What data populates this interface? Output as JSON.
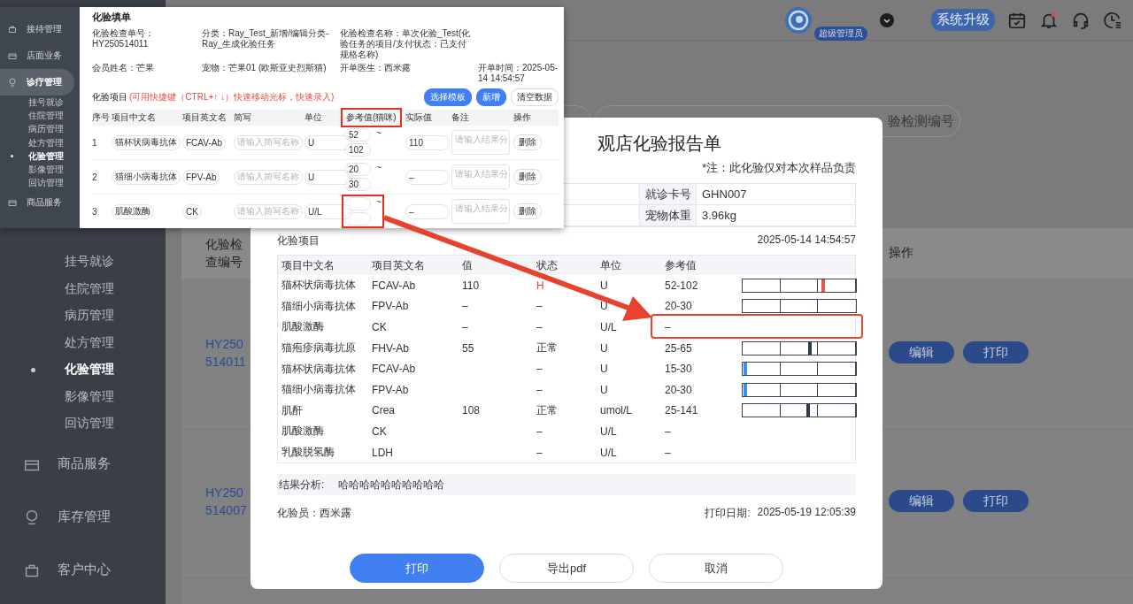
{
  "sidebar": {
    "items": [
      {
        "label": "挂号就诊",
        "kind": "sub",
        "selected": false
      },
      {
        "label": "住院管理",
        "kind": "sub",
        "selected": false
      },
      {
        "label": "病历管理",
        "kind": "sub",
        "selected": false
      },
      {
        "label": "处方管理",
        "kind": "sub",
        "selected": false
      },
      {
        "label": "化验管理",
        "kind": "sub",
        "selected": true
      },
      {
        "label": "影像管理",
        "kind": "sub",
        "selected": false
      },
      {
        "label": "回访管理",
        "kind": "sub",
        "selected": false
      },
      {
        "label": "商品服务",
        "kind": "group",
        "selected": false
      },
      {
        "label": "库存管理",
        "kind": "group",
        "selected": false
      },
      {
        "label": "客户中心",
        "kind": "group",
        "selected": false
      }
    ]
  },
  "header": {
    "role_badge": "超级管理员",
    "upgrade_button": "系统升级",
    "bell_unread": true
  },
  "search": {
    "placeholder": "验检测编号"
  },
  "table": {
    "columns": [
      "化验检查编号",
      "操作"
    ],
    "rows": [
      {
        "id": "HY250514011",
        "actions": [
          "编辑",
          "打印"
        ]
      },
      {
        "id": "HY250514007",
        "actions": [
          "编辑",
          "打印"
        ]
      }
    ]
  },
  "report": {
    "title": "观店化验报告单",
    "note": "*注：此化验仅对本次样品负责",
    "info": [
      {
        "label": "就诊卡号",
        "value": "GHN007"
      },
      {
        "label": "宠物体重",
        "value": "3.96kg"
      }
    ],
    "section": "化验项目",
    "date": "2025-05-14 14:54:57",
    "columns": [
      "项目中文名",
      "项目英文名",
      "值",
      "状态",
      "单位",
      "参考值"
    ],
    "rows": [
      {
        "cn": "猫杯状病毒抗体",
        "en": "FCAV-Ab",
        "value": "110",
        "status": "H",
        "abnormal": true,
        "unit": "U",
        "ref": "52-102",
        "highlighted": false,
        "has_bar": true,
        "marker": {
          "level": 0.72,
          "color": "#e8584a"
        }
      },
      {
        "cn": "猫细小病毒抗体",
        "en": "FPV-Ab",
        "value": "–",
        "status": "–",
        "abnormal": false,
        "unit": "U",
        "ref": "20-30",
        "highlighted": false,
        "has_bar": true
      },
      {
        "cn": "肌酸激酶",
        "en": "CK",
        "value": "–",
        "status": "–",
        "abnormal": false,
        "unit": "U/L",
        "ref": "–",
        "highlighted": true,
        "has_bar": false
      },
      {
        "cn": "猫疱疹病毒抗原",
        "en": "FHV-Ab",
        "value": "55",
        "status": "正常",
        "abnormal": false,
        "unit": "U",
        "ref": "25-65",
        "highlighted": false,
        "has_bar": true,
        "marker": {
          "level": 0.6,
          "color": "#2c3a55"
        }
      },
      {
        "cn": "猫杯状病毒抗体",
        "en": "FCAV-Ab",
        "status": "–",
        "abnormal": false,
        "unit": "U",
        "ref": "15-30",
        "highlighted": false,
        "has_bar": true,
        "marker": {
          "level": 0.01,
          "color": "#3a8ef0"
        }
      },
      {
        "cn": "猫细小病毒抗体",
        "en": "FPV-Ab",
        "status": "–",
        "abnormal": false,
        "unit": "U",
        "ref": "20-30",
        "highlighted": false,
        "has_bar": true,
        "marker": {
          "level": 0.01,
          "color": "#3a8ef0"
        }
      },
      {
        "cn": "肌酐",
        "en": "Crea",
        "value": "108",
        "status": "正常",
        "abnormal": false,
        "unit": "umol/L",
        "ref": "25-141",
        "highlighted": false,
        "has_bar": true,
        "marker": {
          "level": 0.58,
          "color": "#2c3a55"
        }
      },
      {
        "cn": "肌酸激酶",
        "en": "CK",
        "status": "–",
        "abnormal": false,
        "unit": "U/L",
        "ref": "–",
        "highlighted": false,
        "has_bar": false
      },
      {
        "cn": "乳酸脱氢酶",
        "en": "LDH",
        "status": "–",
        "abnormal": false,
        "unit": "U/L",
        "ref": "–",
        "highlighted": false,
        "has_bar": false
      }
    ],
    "analysis_label": "结果分析:",
    "analysis": "哈哈哈哈哈哈哈哈哈哈",
    "tester": "化验员：西米露",
    "print_date_label": "打印日期:",
    "print_date": "2025-05-19 12:05:39",
    "buttons": [
      {
        "label": "打印",
        "kind": "primary"
      },
      {
        "label": "导出pdf",
        "kind": "plain"
      },
      {
        "label": "取消",
        "kind": "plain"
      }
    ]
  },
  "inset": {
    "sidebar": [
      {
        "label": "接待管理",
        "kind": "group",
        "selected": false
      },
      {
        "label": "店面业务",
        "kind": "group",
        "selected": false
      },
      {
        "label": "诊疗管理",
        "kind": "group",
        "selected": true
      },
      {
        "label": "挂号就诊",
        "kind": "sub",
        "selected": false
      },
      {
        "label": "住院管理",
        "kind": "sub",
        "selected": false
      },
      {
        "label": "病历管理",
        "kind": "sub",
        "selected": false
      },
      {
        "label": "处方管理",
        "kind": "sub",
        "selected": false
      },
      {
        "label": "化验管理",
        "kind": "sub",
        "selected": true
      },
      {
        "label": "影像管理",
        "kind": "sub",
        "selected": false
      },
      {
        "label": "回访管理",
        "kind": "sub",
        "selected": false
      },
      {
        "label": "商品服务",
        "kind": "group",
        "selected": false
      }
    ],
    "title": "化验填单",
    "fields": [
      "化验检查单号：HY250514011",
      "分类：Ray_Test_新增/编辑分类-Ray_生成化验任务",
      "化验检查名称：单次化验_Test(化验任务的项目/支付状态：已支付规格名称)",
      "会员姓名：芒果",
      "宠物：芒果01 (欧斯亚史烈斯猫)",
      "开单医生：西米露",
      "开单时间：2025-05-14 14:54:57"
    ],
    "section": "化验项目",
    "hint": "(可用快捷键（CTRL+↑ ↓）快速移动光标，快速录入)",
    "buttons": [
      {
        "label": "选择模板",
        "kind": "primary"
      },
      {
        "label": "新增",
        "kind": "primary"
      },
      {
        "label": "清空数据",
        "kind": "plain"
      }
    ],
    "columns": [
      {
        "label": "序号",
        "highlighted": false
      },
      {
        "label": "项目中文名",
        "highlighted": false
      },
      {
        "label": "项目英文名",
        "highlighted": false
      },
      {
        "label": "简写",
        "highlighted": false
      },
      {
        "label": "单位",
        "highlighted": false
      },
      {
        "label": "参考值(猫咪)",
        "highlighted": true
      },
      {
        "label": "实际值",
        "highlighted": false
      },
      {
        "label": "备注",
        "highlighted": false
      },
      {
        "label": "操作",
        "highlighted": false
      }
    ],
    "rows": [
      {
        "no": "1",
        "cn": "猫杯状病毒抗体",
        "en": "FCAV-Ab",
        "abbr_placeholder": "请输入简写名称",
        "unit": "U",
        "ref_low": "52",
        "ref_high": "102",
        "separator": "~",
        "ref_highlighted": false,
        "actual": "110",
        "note_placeholder": "请输入结果分",
        "action": "删除"
      },
      {
        "no": "2",
        "cn": "猫细小病毒抗体",
        "en": "FPV-Ab",
        "abbr_placeholder": "请输入简写名称",
        "unit": "U",
        "ref_low": "20",
        "ref_high": "30",
        "separator": "~",
        "ref_highlighted": false,
        "actual": "–",
        "note_placeholder": "请输入结果分",
        "action": "删除"
      },
      {
        "no": "3",
        "cn": "肌酸激酶",
        "en": "CK",
        "abbr_placeholder": "请输入简写名称",
        "unit": "U/L",
        "separator": "~",
        "ref_highlighted": true,
        "actual": "–",
        "note_placeholder": "请输入结果分",
        "action": "删除"
      }
    ]
  }
}
